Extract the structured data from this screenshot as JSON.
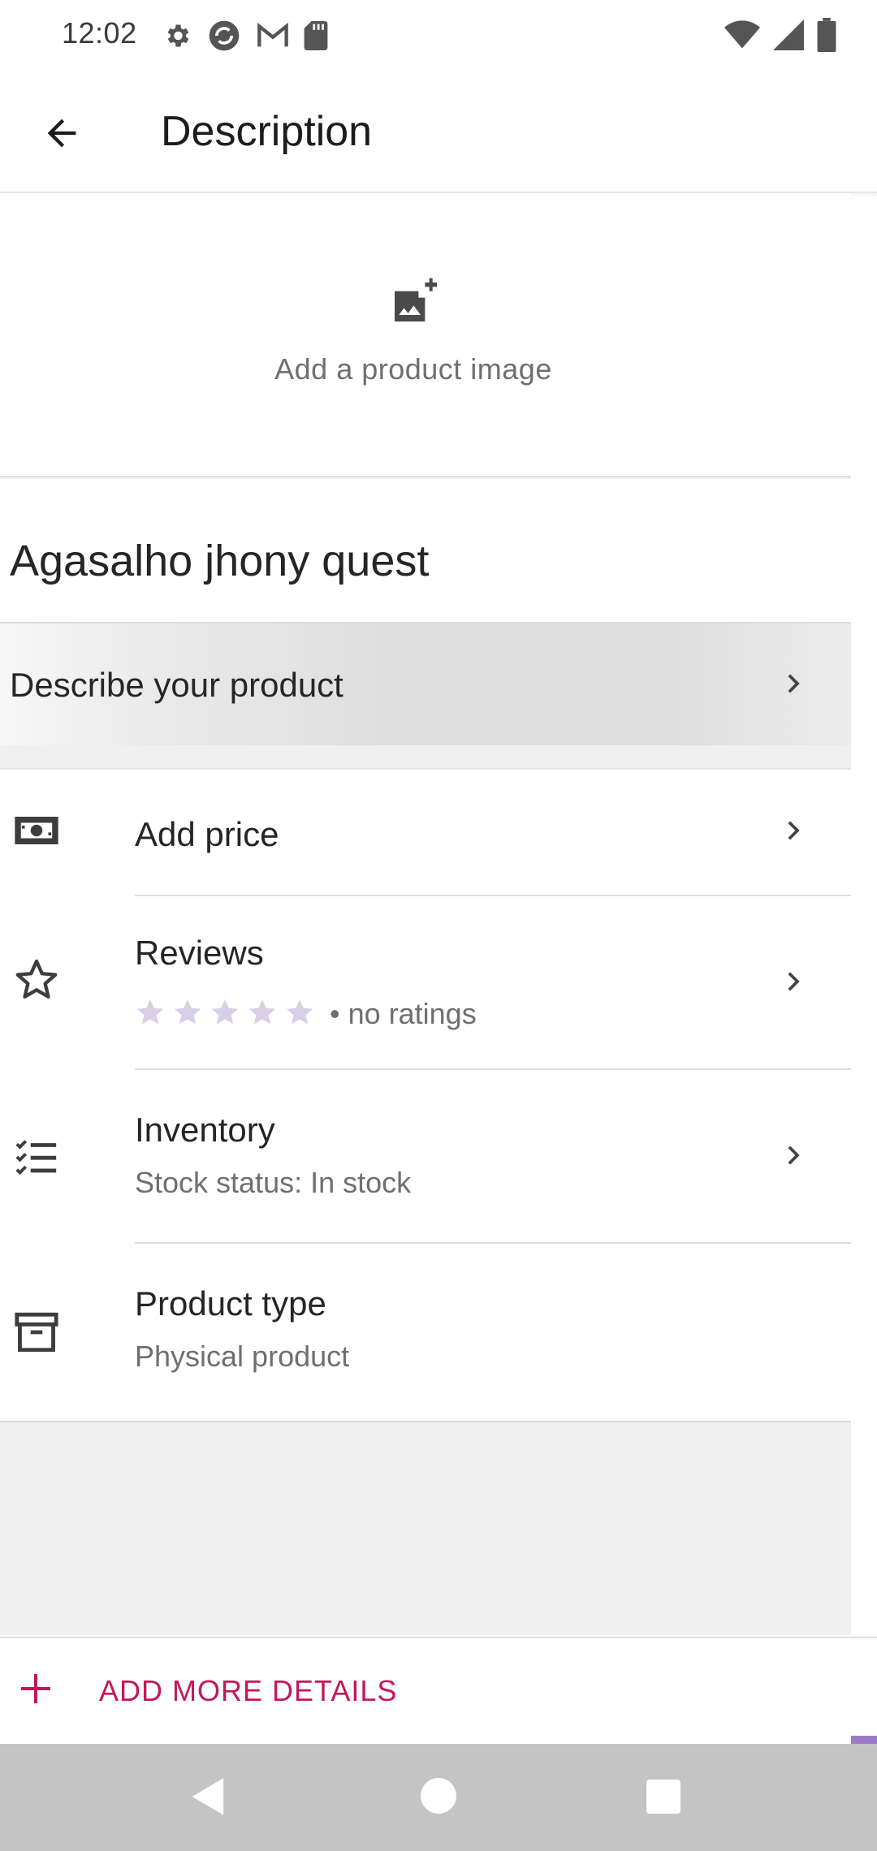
{
  "status_bar": {
    "time": "12:02",
    "left_icons": [
      "gear-icon",
      "sync-icon",
      "gmail-icon",
      "sd-card-icon"
    ],
    "right_icons": [
      "wifi-icon",
      "signal-icon",
      "battery-icon"
    ]
  },
  "app_bar": {
    "back_icon": "arrow-back-icon",
    "title": "Description"
  },
  "image_section": {
    "icon": "add-photo-icon",
    "label": "Add a product image"
  },
  "product": {
    "name": "Agasalho jhony quest",
    "describe_label": "Describe your product"
  },
  "details": {
    "price": {
      "icon": "money-icon",
      "title": "Add price"
    },
    "reviews": {
      "icon": "star-outline-icon",
      "title": "Reviews",
      "rating": 0,
      "max_rating": 5,
      "ratings_text": "• no ratings"
    },
    "inventory": {
      "icon": "checklist-icon",
      "title": "Inventory",
      "subtitle": "Stock status: In stock"
    },
    "product_type": {
      "icon": "archive-box-icon",
      "title": "Product type",
      "subtitle": "Physical product"
    }
  },
  "add_more": {
    "icon": "plus-icon",
    "label": "ADD MORE DETAILS",
    "color": "#c2185b"
  },
  "nav_bar": {
    "buttons": [
      "nav-back-icon",
      "nav-home-icon",
      "nav-recents-icon"
    ]
  },
  "colors": {
    "star_inactive": "#d8cfe6",
    "accent": "#c2185b"
  }
}
